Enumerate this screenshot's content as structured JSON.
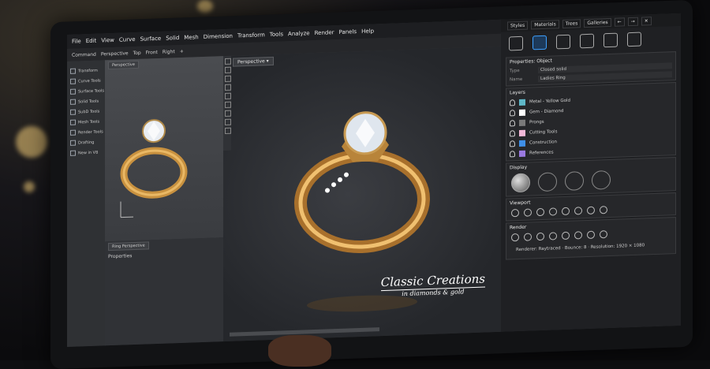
{
  "menu": [
    "File",
    "Edit",
    "View",
    "Curve",
    "Surface",
    "Solid",
    "Mesh",
    "Dimension",
    "Transform",
    "Tools",
    "Analyze",
    "Render",
    "Panels",
    "Help"
  ],
  "command_bar": [
    "Command",
    "Perspective",
    "Top",
    "Front",
    "Right",
    "+"
  ],
  "tools": [
    "Transform",
    "Curve Tools",
    "Surface Tools",
    "Solid Tools",
    "SubD Tools",
    "Mesh Tools",
    "Render Tools",
    "Drafting",
    "New in V8"
  ],
  "left_viewport": {
    "tab": "Perspective",
    "bottom_tab": "Ring Perspective",
    "properties_label": "Properties"
  },
  "main_viewport": {
    "tab": "Perspective"
  },
  "logo": {
    "line1": "Classic Creations",
    "line2": "in diamonds & gold"
  },
  "right_tabs": [
    "Styles",
    "Materials",
    "Trees",
    "Galleries"
  ],
  "properties": {
    "title": "Properties: Object",
    "rows": [
      {
        "key": "Type",
        "value": "Closed solid"
      },
      {
        "key": "Name",
        "value": "Ladies Ring"
      }
    ]
  },
  "layers": {
    "title": "Layers",
    "items": [
      {
        "name": "Metal - Yellow Gold",
        "color": "#5fb8c8"
      },
      {
        "name": "Gem - Diamond",
        "color": "#ffffff"
      },
      {
        "name": "Prongs",
        "color": "#7a7a7a"
      },
      {
        "name": "Cutting Tools",
        "color": "#f2b8d8"
      },
      {
        "name": "Construction",
        "color": "#3f8fe8"
      },
      {
        "name": "References",
        "color": "#9a7ae0"
      }
    ]
  },
  "display": {
    "title": "Display"
  },
  "viewport": {
    "title": "Viewport"
  },
  "render": {
    "title": "Render",
    "status": "Renderer:  Raytraced  ·  Bounce: 8  ·  Resolution: 1920 × 1080"
  }
}
